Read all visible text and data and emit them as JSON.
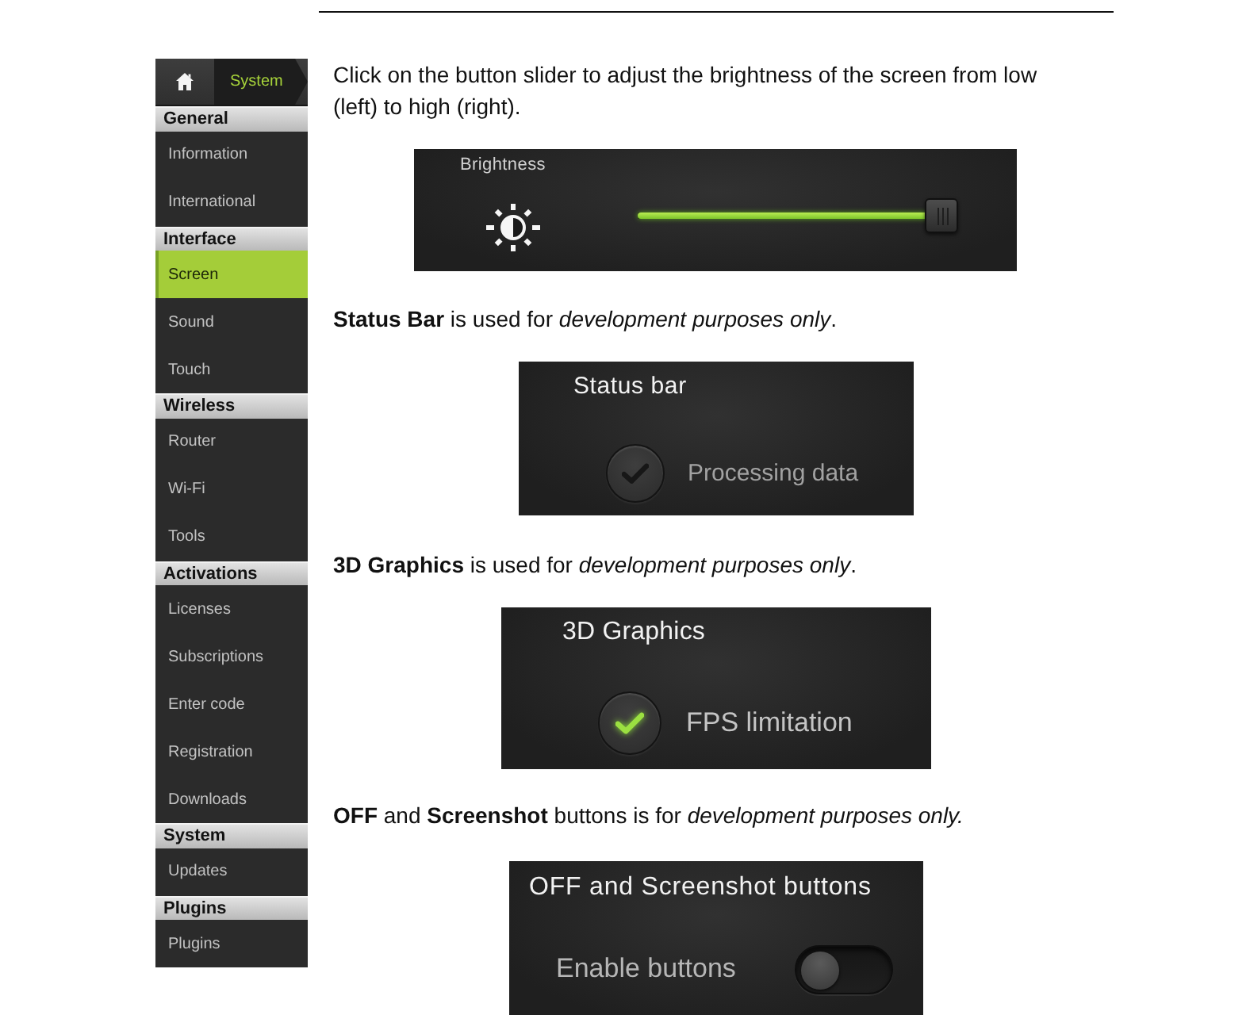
{
  "sidebar": {
    "breadcrumb": "System",
    "sections": [
      {
        "title": "General",
        "items": [
          {
            "label": "Information",
            "selected": false
          },
          {
            "label": "International",
            "selected": false
          }
        ]
      },
      {
        "title": "Interface",
        "items": [
          {
            "label": "Screen",
            "selected": true
          },
          {
            "label": "Sound",
            "selected": false
          },
          {
            "label": "Touch",
            "selected": false
          }
        ]
      },
      {
        "title": "Wireless",
        "items": [
          {
            "label": "Router",
            "selected": false
          },
          {
            "label": "Wi-Fi",
            "selected": false
          },
          {
            "label": "Tools",
            "selected": false
          }
        ]
      },
      {
        "title": "Activations",
        "items": [
          {
            "label": "Licenses",
            "selected": false
          },
          {
            "label": "Subscriptions",
            "selected": false
          },
          {
            "label": "Enter code",
            "selected": false
          },
          {
            "label": "Registration",
            "selected": false
          },
          {
            "label": "Downloads",
            "selected": false
          }
        ]
      },
      {
        "title": "System",
        "items": [
          {
            "label": "Updates",
            "selected": false
          }
        ]
      },
      {
        "title": "Plugins",
        "items": [
          {
            "label": "Plugins",
            "selected": false
          }
        ]
      }
    ]
  },
  "content": {
    "blocks": [
      {
        "kind": "text",
        "text": "Click on the button slider to adjust the brightness of the screen from low (left) to high (right)."
      },
      {
        "kind": "slider",
        "title": "Brightness",
        "level": 1
      },
      {
        "kind": "text",
        "text": "**Status Bar** is used for *development purposes only*."
      },
      {
        "kind": "checkbox",
        "title": "Status bar",
        "label": "Processing data",
        "checked": false
      },
      {
        "kind": "text",
        "text": "**3D Graphics** is used for *development purposes only*."
      },
      {
        "kind": "checkbox",
        "title": "3D Graphics",
        "label": "FPS limitation",
        "checked": true
      },
      {
        "kind": "text",
        "text": "**OFF** and **Screenshot** buttons is for *development purposes only.*"
      },
      {
        "kind": "toggle",
        "title": "OFF and Screenshot buttons",
        "label": "Enable buttons",
        "on": false
      }
    ]
  }
}
